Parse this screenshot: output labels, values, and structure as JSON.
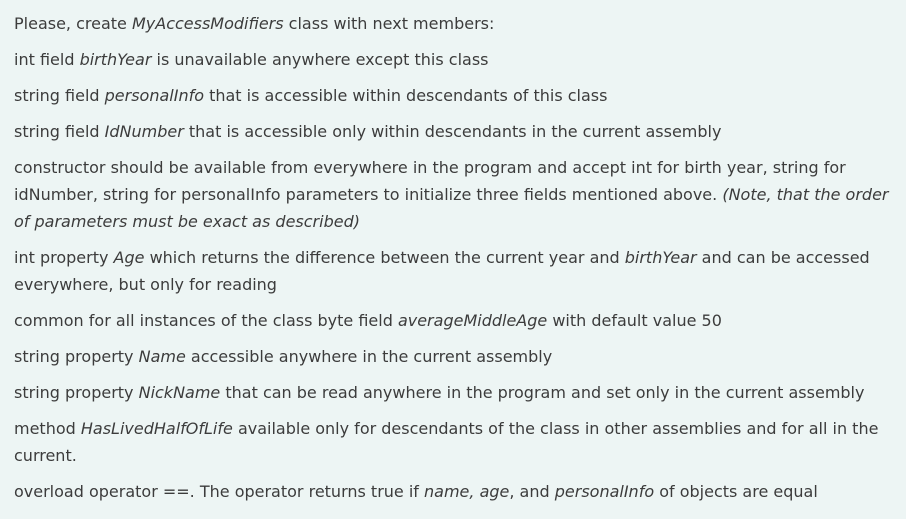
{
  "lines": [
    [
      {
        "t": "Please, create ",
        "i": false
      },
      {
        "t": "MyAccessModifiers",
        "i": true
      },
      {
        "t": " class with next members:",
        "i": false
      }
    ],
    [
      {
        "t": "int field ",
        "i": false
      },
      {
        "t": "birthYear",
        "i": true
      },
      {
        "t": " is unavailable anywhere except this class",
        "i": false
      }
    ],
    [
      {
        "t": "string field ",
        "i": false
      },
      {
        "t": "personalInfo",
        "i": true
      },
      {
        "t": " that is accessible within descendants of this class",
        "i": false
      }
    ],
    [
      {
        "t": "string field ",
        "i": false
      },
      {
        "t": "IdNumber",
        "i": true
      },
      {
        "t": " that is accessible only within descendants in the current assembly",
        "i": false
      }
    ],
    [
      {
        "t": "constructor should be available from everywhere in the program and accept int for birth year, string for idNumber, string for personalInfo parameters to initialize three fields mentioned above. ",
        "i": false
      },
      {
        "t": "(Note, that the order of parameters must be exact as described)",
        "i": true
      }
    ],
    [
      {
        "t": "int property ",
        "i": false
      },
      {
        "t": "Age",
        "i": true
      },
      {
        "t": " which returns the difference between the current year and ",
        "i": false
      },
      {
        "t": "birthYear",
        "i": true
      },
      {
        "t": " and can be accessed everywhere, but only for reading",
        "i": false
      }
    ],
    [
      {
        "t": "common for all instances of the class byte field ",
        "i": false
      },
      {
        "t": "averageMiddleAge",
        "i": true
      },
      {
        "t": " with default value 50",
        "i": false
      }
    ],
    [
      {
        "t": "string property ",
        "i": false
      },
      {
        "t": "Name",
        "i": true
      },
      {
        "t": " accessible anywhere in the current assembly",
        "i": false
      }
    ],
    [
      {
        "t": "string property ",
        "i": false
      },
      {
        "t": "NickName",
        "i": true
      },
      {
        "t": " that can be read anywhere in the program and set only in the current assembly",
        "i": false
      }
    ],
    [
      {
        "t": "method ",
        "i": false
      },
      {
        "t": "HasLivedHalfOfLife",
        "i": true
      },
      {
        "t": " available only for descendants of the class in other assemblies and for all in the current.",
        "i": false
      }
    ],
    [
      {
        "t": "overload operator ==. The operator returns true if ",
        "i": false
      },
      {
        "t": "name, age",
        "i": true
      },
      {
        "t": ", and ",
        "i": false
      },
      {
        "t": "personalInfo",
        "i": true
      },
      {
        "t": "  of objects are equal",
        "i": false
      }
    ]
  ]
}
